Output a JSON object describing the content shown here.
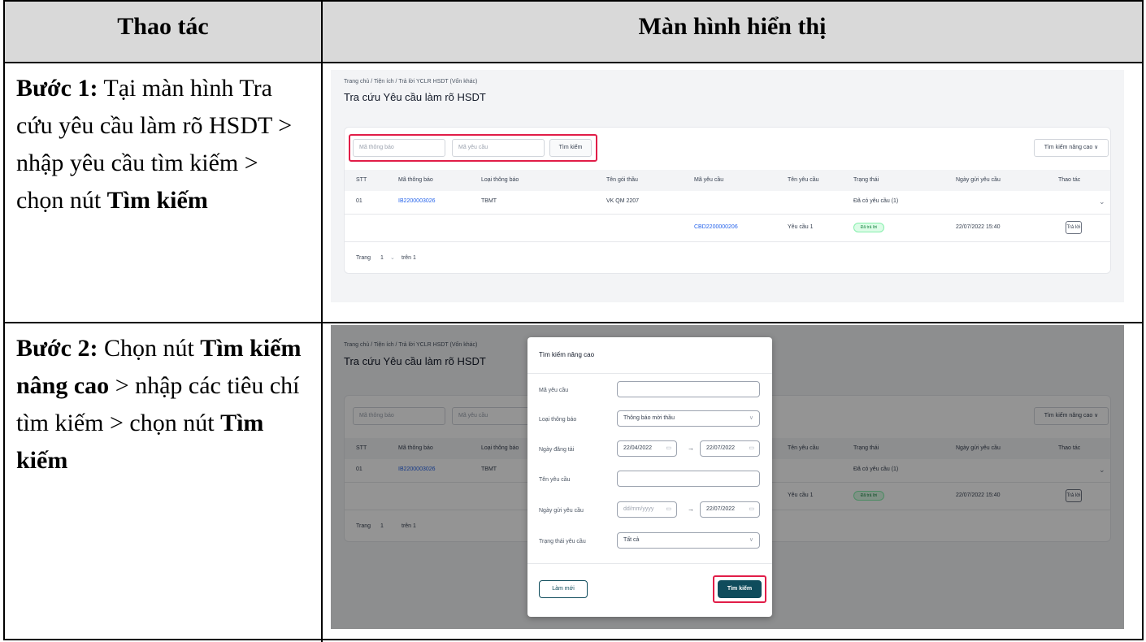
{
  "header": {
    "col1": "Thao tác",
    "col2": "Màn hình hiển thị"
  },
  "step1": {
    "label": "Bước 1:",
    "text_a": " Tại màn hình Tra cứu yêu cầu làm rõ HSDT > nhập yêu cầu tìm kiếm > chọn nút ",
    "button_name": "Tìm kiếm"
  },
  "step2": {
    "label": "Bước 2:",
    "text_a": " Chọn nút ",
    "adv_name": "Tìm kiếm nâng cao",
    "text_b": " > nhập các tiêu chí tìm kiếm > chọn nút ",
    "button_name": "Tìm kiếm"
  },
  "screen": {
    "breadcrumb": "Trang chủ  /  Tiện ích  /  Trả lời YCLR HSDT (Vốn khác)",
    "title": "Tra cứu Yêu cầu làm rõ HSDT",
    "notice_code_placeholder": "Mã thông báo",
    "request_code_placeholder": "Mã yêu cầu",
    "search_label": "Tìm kiếm",
    "advanced_label": "Tìm kiếm nâng cao  ∨",
    "columns": [
      "STT",
      "Mã thông báo",
      "Loại thông báo",
      "Tên gói thầu",
      "Mã yêu cầu",
      "Tên yêu cầu",
      "Trạng thái",
      "Ngày gửi yêu cầu",
      "Thao tác"
    ],
    "row1": {
      "stt": "01",
      "notice_code": "IB2200003026",
      "notice_type": "TBMT",
      "package": "VK QM 2207",
      "status": "Đã có yêu cầu (1)"
    },
    "row2": {
      "request_code": "CBD2200000206",
      "request_name": "Yêu cầu 1",
      "status_badge": "Đã trả lời",
      "sent_date": "22/07/2022 15:40",
      "action": "Trả lời"
    },
    "pagination": {
      "label": "Trang",
      "page": "1",
      "total": "trên 1"
    }
  },
  "modal": {
    "title": "Tìm kiếm nâng cao",
    "request_code_label": "Mã yêu cầu",
    "notice_type_label": "Loại thông báo",
    "notice_type_value": "Thông báo mời thầu",
    "posted_date_label": "Ngày đăng tải",
    "posted_from": "22/04/2022",
    "posted_to": "22/07/2022",
    "request_name_label": "Tên yêu cầu",
    "sent_date_label": "Ngày gửi yêu cầu",
    "sent_from_placeholder": "dd/mm/yyyy",
    "sent_to": "22/07/2022",
    "status_label": "Trạng thái yêu cầu",
    "status_value": "Tất cả",
    "reset_label": "Làm mới",
    "search_label": "Tìm kiếm"
  }
}
